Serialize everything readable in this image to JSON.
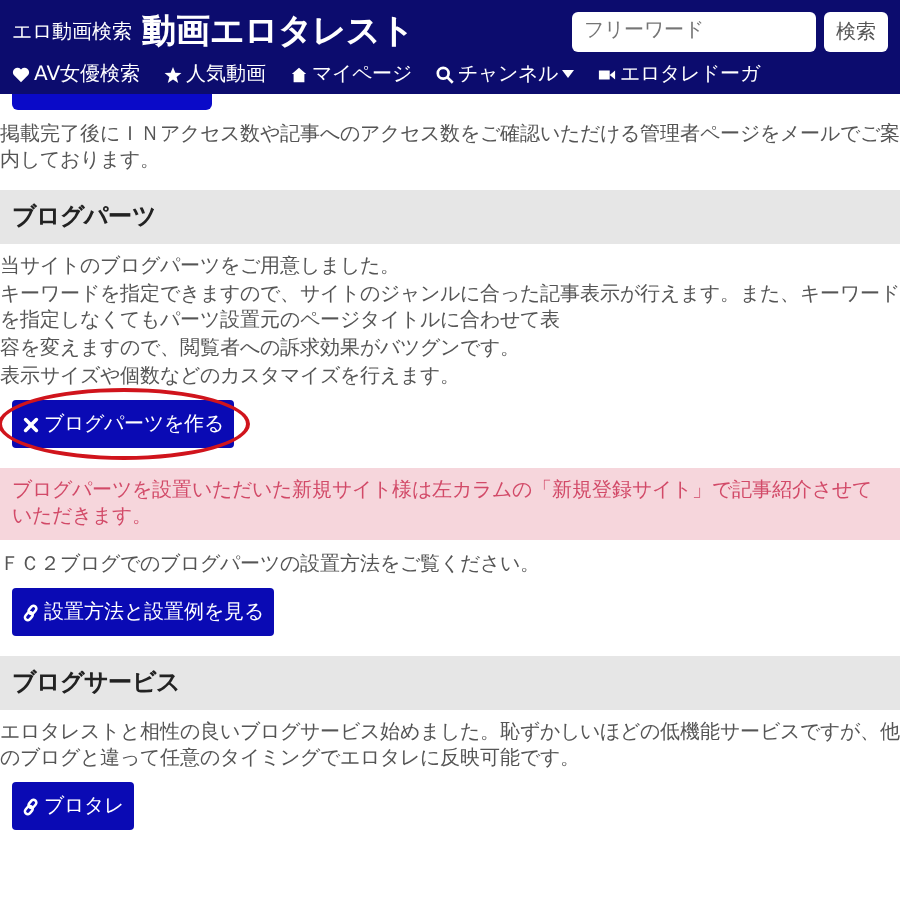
{
  "header": {
    "logo_caption": "エロ動画検索",
    "logo": "動画エロタレスト",
    "nav": [
      {
        "label": "AV女優検索",
        "dropdown": false
      },
      {
        "label": "人気動画",
        "dropdown": false
      },
      {
        "label": "マイページ",
        "dropdown": false
      },
      {
        "label": "チャンネル",
        "dropdown": true
      },
      {
        "label": "エロタレドーガ",
        "dropdown": false
      }
    ],
    "search": {
      "placeholder": "フリーワード",
      "button": "検索"
    }
  },
  "intro": "掲載完了後にＩＮアクセス数や記事へのアクセス数をご確認いただける管理者ページをメールでご案内しております。",
  "sections": [
    {
      "heading": "ブログパーツ",
      "blocks": [
        {
          "kind": "text",
          "text": "当サイトのブログパーツをご用意しました。"
        },
        {
          "kind": "text",
          "text": "キーワードを指定できますので、サイトのジャンルに合った記事表示が行えます。また、キーワードを指定しなくてもパーツ設置元のページタイトルに合わせて表"
        },
        {
          "kind": "text",
          "text": "容を変えますので、閲覧者への訴求効果がバツグンです。"
        },
        {
          "kind": "text",
          "text": "表示サイズや個数などのカスタマイズを行えます。"
        },
        {
          "kind": "tool_button",
          "label": "ブログパーツを作る",
          "circled": true
        },
        {
          "kind": "notice",
          "text": "ブログパーツを設置いただいた新規サイト様は左カラムの「新規登録サイト」で記事紹介させていただきます。"
        },
        {
          "kind": "text",
          "text": "ＦＣ２ブログでのブログパーツの設置方法をご覧ください。"
        },
        {
          "kind": "link_button",
          "label": "設置方法と設置例を見る",
          "circled": false
        }
      ]
    },
    {
      "heading": "ブログサービス",
      "blocks": [
        {
          "kind": "text",
          "text": "エロタレストと相性の良いブログサービス始めました。恥ずかしいほどの低機能サービスですが、他のブログと違って任意のタイミングでエロタレに反映可能です。"
        },
        {
          "kind": "link_button",
          "label": "ブロタレ",
          "circled": false
        }
      ]
    }
  ]
}
